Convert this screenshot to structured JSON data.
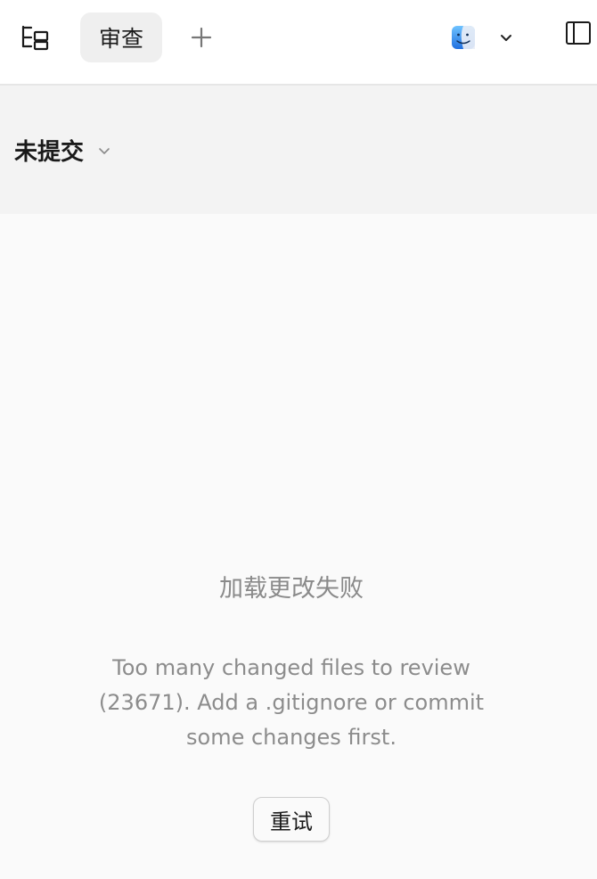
{
  "header": {
    "tab_label": "审查",
    "icons": {
      "left": "tree-view-icon",
      "add": "plus-icon",
      "app": "finder-icon",
      "app_menu": "chevron-down-icon",
      "right": "sidebar-toggle-icon"
    }
  },
  "subheader": {
    "status_label": "未提交"
  },
  "main": {
    "error_title": "加载更改失败",
    "error_message": "Too many changed files to review (23671). Add a .gitignore or commit some changes first.",
    "retry_label": "重试"
  },
  "colors": {
    "background": "#fafafa",
    "header_bg": "#ffffff",
    "subheader_bg": "#f3f3f3",
    "tab_bg": "#efefef",
    "muted_text": "#8a8a8a",
    "finder_blue": "#3b8fe6"
  }
}
